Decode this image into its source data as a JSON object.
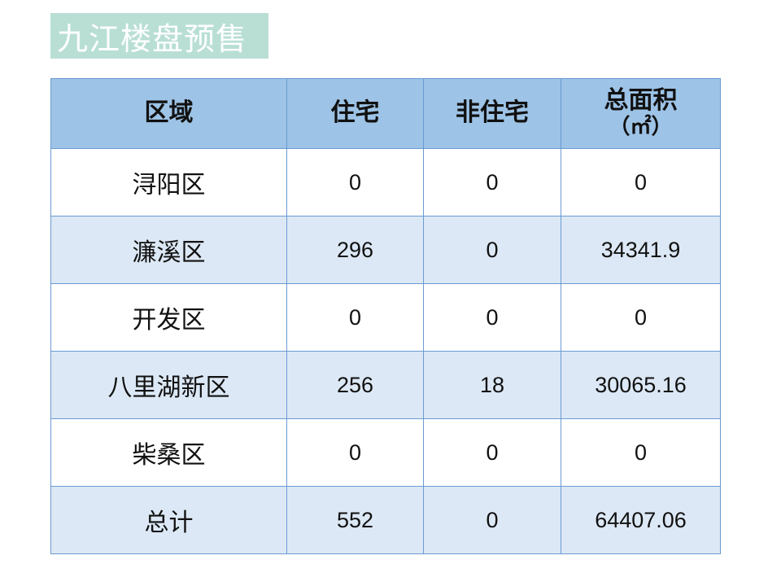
{
  "title": "九江楼盘预售",
  "table": {
    "headers": [
      "区域",
      "住宅",
      "非住宅",
      "总面积"
    ],
    "area_unit": "（㎡）",
    "rows": [
      {
        "region": "浔阳区",
        "residential": "0",
        "non_residential": "0",
        "total_area": "0"
      },
      {
        "region": "濂溪区",
        "residential": "296",
        "non_residential": "0",
        "total_area": "34341.9"
      },
      {
        "region": "开发区",
        "residential": "0",
        "non_residential": "0",
        "total_area": "0"
      },
      {
        "region": "八里湖新区",
        "residential": "256",
        "non_residential": "18",
        "total_area": "30065.16"
      },
      {
        "region": "柴桑区",
        "residential": "0",
        "non_residential": "0",
        "total_area": "0"
      },
      {
        "region": "总计",
        "residential": "552",
        "non_residential": "0",
        "total_area": "64407.06"
      }
    ]
  },
  "colors": {
    "title_background": "#b9dfd5",
    "header_background": "#9dc3e6",
    "stripe_background": "#dce8f5",
    "border": "#6a9bd3"
  }
}
